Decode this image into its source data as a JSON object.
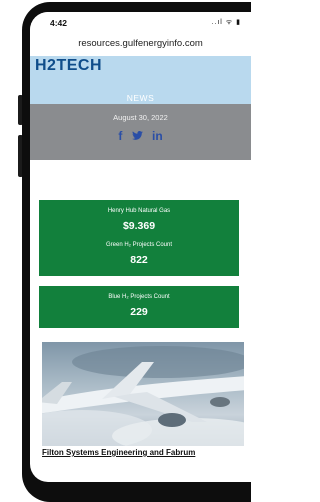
{
  "status": {
    "time": "4:42",
    "icons": "..ıl ᯤ ▮"
  },
  "browser": {
    "url": "resources.gulfenergyinfo.com"
  },
  "header": {
    "logo": "H2TECH",
    "section": "NEWS"
  },
  "date_band": {
    "date": "August 30, 2022",
    "social_icons": [
      "facebook-icon",
      "twitter-icon",
      "linkedin-icon"
    ],
    "social_glyphs": [
      "f",
      "🐦",
      "in"
    ]
  },
  "stats": [
    {
      "label": "Henry Hub Natural Gas",
      "value": "$9.369"
    },
    {
      "label": "Green H₂ Projects Count",
      "value": "822"
    },
    {
      "label": "Blue H₂ Projects Count",
      "value": "229"
    }
  ],
  "article": {
    "image": "airplane-in-clouds",
    "title": "Filton Systems Engineering and Fabrum"
  },
  "colors": {
    "header": "#b9d9ee",
    "band": "#8a8c8f",
    "stat_box": "#12803c",
    "logo": "#0f4d8a"
  }
}
